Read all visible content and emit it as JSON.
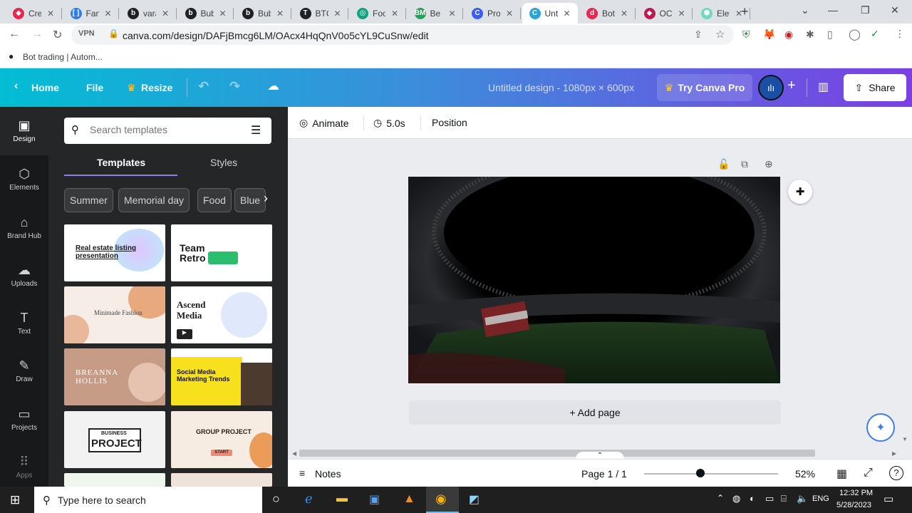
{
  "browser": {
    "tabs": [
      {
        "title": "Cre",
        "fav_color": "#e8274f",
        "fav_glyph": "◆"
      },
      {
        "title": "Fan",
        "fav_color": "#2d7cf6",
        "fav_glyph": "[ ]"
      },
      {
        "title": "vara",
        "fav_color": "#202124",
        "fav_glyph": "b"
      },
      {
        "title": "Bub",
        "fav_color": "#202124",
        "fav_glyph": "b"
      },
      {
        "title": "Bub",
        "fav_color": "#202124",
        "fav_glyph": "b"
      },
      {
        "title": "BTC",
        "fav_color": "#202124",
        "fav_glyph": "T"
      },
      {
        "title": "Foo",
        "fav_color": "#10a37f",
        "fav_glyph": "◎"
      },
      {
        "title": "Be I",
        "fav_color": "#22a55a",
        "fav_glyph": "BM"
      },
      {
        "title": "Proj",
        "fav_color": "#3a5ef5",
        "fav_glyph": "C"
      },
      {
        "title": "Unt",
        "fav_color": "#2aa4d8",
        "fav_glyph": "C"
      },
      {
        "title": "Bot",
        "fav_color": "#e8274f",
        "fav_glyph": "d"
      },
      {
        "title": "OCI",
        "fav_color": "#c0184e",
        "fav_glyph": "◆"
      },
      {
        "title": "Elev",
        "fav_color": "#6fd8c0",
        "fav_glyph": "⬢"
      }
    ],
    "active_tab_index": 9,
    "url": "canva.com/design/DAFjBmcg6LM/OAcx4HqQnV0o5cYL9CuSnw/edit",
    "bookmark": "Bot trading | Autom..."
  },
  "canva": {
    "home": "Home",
    "file": "File",
    "resize": "Resize",
    "design_title": "Untitled design - 1080px × 600px",
    "try_pro": "Try Canva Pro",
    "share": "Share",
    "rail": [
      "Design",
      "Elements",
      "Brand Hub",
      "Uploads",
      "Text",
      "Draw",
      "Projects",
      "Apps"
    ],
    "search_placeholder": "Search templates",
    "panel_tabs": [
      "Templates",
      "Styles"
    ],
    "chips": [
      "Summer",
      "Memorial day",
      "Food",
      "Blue"
    ],
    "thumbs": {
      "t1": "Real estate listing presentation",
      "t2": "Team Retro",
      "t3": "Minimade Fashion",
      "t4": "Ascend Media",
      "t5": "BREANNA HOLLIS",
      "t6": "Social Media Marketing Trends",
      "t7a": "BUSINESS",
      "t7b": "PROJECT",
      "t8": "GROUP PROJECT",
      "t8b": "START"
    },
    "toolbar": {
      "animate": "Animate",
      "duration": "5.0s",
      "position": "Position"
    },
    "add_page": "+ Add page",
    "notes": "Notes",
    "page_indicator": "Page 1 / 1",
    "zoom": "52%",
    "zoom_fraction": 0.42
  },
  "taskbar": {
    "search_placeholder": "Type here to search",
    "language": "ENG",
    "time": "12:32 PM",
    "date": "5/28/2023"
  }
}
